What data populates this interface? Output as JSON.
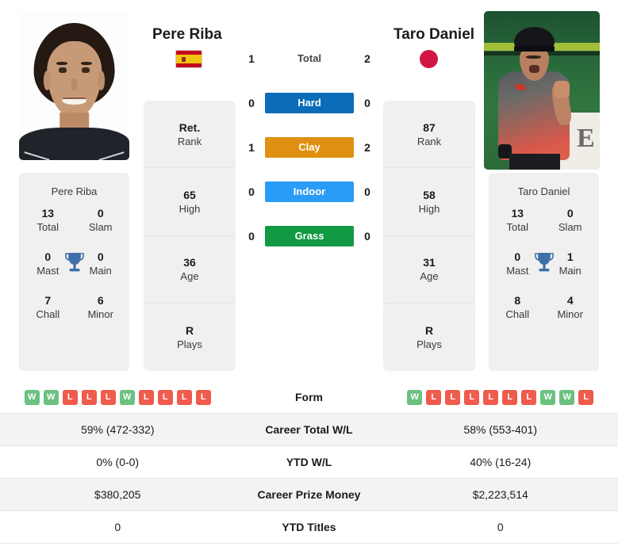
{
  "players": {
    "left": {
      "name": "Pere Riba",
      "flag_icon": "flag-spain-icon",
      "photo_alt": "Pere Riba headshot",
      "stats": [
        {
          "value": "Ret.",
          "label": "Rank"
        },
        {
          "value": "65",
          "label": "High"
        },
        {
          "value": "36",
          "label": "Age"
        },
        {
          "value": "R",
          "label": "Plays"
        }
      ],
      "titles": {
        "name": "Pere Riba",
        "rows": [
          [
            {
              "value": "13",
              "label": "Total"
            },
            {
              "value": "0",
              "label": "Slam"
            }
          ],
          [
            {
              "value": "0",
              "label": "Mast"
            },
            {
              "value": "0",
              "label": "Main"
            }
          ],
          [
            {
              "value": "7",
              "label": "Chall"
            },
            {
              "value": "6",
              "label": "Minor"
            }
          ]
        ]
      },
      "form": [
        "W",
        "W",
        "L",
        "L",
        "L",
        "W",
        "L",
        "L",
        "L",
        "L"
      ],
      "career_wl": "59% (472-332)",
      "ytd_wl": "0% (0-0)",
      "prize_money": "$380,205",
      "ytd_titles": "0"
    },
    "right": {
      "name": "Taro Daniel",
      "flag_icon": "flag-japan-icon",
      "photo_alt": "Taro Daniel action shot",
      "stats": [
        {
          "value": "87",
          "label": "Rank"
        },
        {
          "value": "58",
          "label": "High"
        },
        {
          "value": "31",
          "label": "Age"
        },
        {
          "value": "R",
          "label": "Plays"
        }
      ],
      "titles": {
        "name": "Taro Daniel",
        "rows": [
          [
            {
              "value": "13",
              "label": "Total"
            },
            {
              "value": "0",
              "label": "Slam"
            }
          ],
          [
            {
              "value": "0",
              "label": "Mast"
            },
            {
              "value": "1",
              "label": "Main"
            }
          ],
          [
            {
              "value": "8",
              "label": "Chall"
            },
            {
              "value": "4",
              "label": "Minor"
            }
          ]
        ]
      },
      "form": [
        "W",
        "L",
        "L",
        "L",
        "L",
        "L",
        "L",
        "W",
        "W",
        "L"
      ],
      "career_wl": "58% (553-401)",
      "ytd_wl": "40% (16-24)",
      "prize_money": "$2,223,514",
      "ytd_titles": "0"
    }
  },
  "h2h": [
    {
      "label": "Total",
      "left": "1",
      "right": "2",
      "badge": false,
      "color": ""
    },
    {
      "label": "Hard",
      "left": "0",
      "right": "0",
      "badge": true,
      "color": "#0b6cb8"
    },
    {
      "label": "Clay",
      "left": "1",
      "right": "2",
      "badge": true,
      "color": "#e09010"
    },
    {
      "label": "Indoor",
      "left": "0",
      "right": "0",
      "badge": true,
      "color": "#2b9cf5"
    },
    {
      "label": "Grass",
      "left": "0",
      "right": "0",
      "badge": true,
      "color": "#119944"
    }
  ],
  "comparison_rows": [
    {
      "label": "Form",
      "key": "form",
      "shaded": false
    },
    {
      "label": "Career Total W/L",
      "key": "career_wl",
      "shaded": true
    },
    {
      "label": "YTD W/L",
      "key": "ytd_wl",
      "shaded": false
    },
    {
      "label": "Career Prize Money",
      "key": "prize_money",
      "shaded": true
    },
    {
      "label": "YTD Titles",
      "key": "ytd_titles",
      "shaded": false
    }
  ],
  "theme": {
    "card_bg": "#f0f0f0",
    "shaded_row": "#f3f3f3",
    "win_badge": "#6cc180",
    "loss_badge": "#ef5b4c",
    "trophy": "#3f6fa8"
  }
}
